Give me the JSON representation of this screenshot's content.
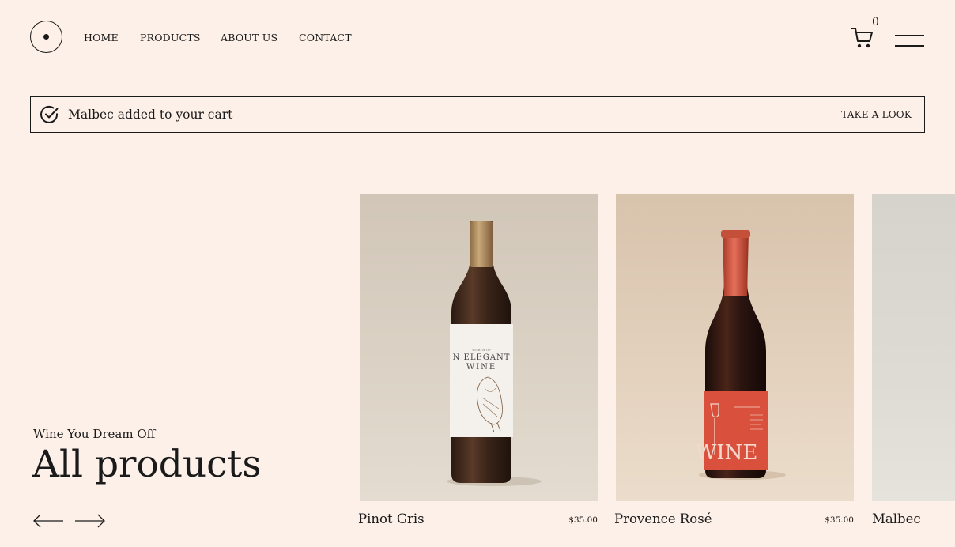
{
  "header": {
    "nav": [
      "HOME",
      "PRODUCTS",
      "ABOUT US",
      "CONTACT"
    ],
    "cart_count": "0"
  },
  "notice": {
    "message": "Malbec added to your cart",
    "action": "TAKE A LOOK"
  },
  "hero": {
    "tagline": "Wine You Dream Off",
    "title": "All products"
  },
  "products": [
    {
      "name": "Pinot Gris",
      "price": "$35.00",
      "label_line1": "N ELEGANT",
      "label_line2": "WINE"
    },
    {
      "name": "Provence Rosé",
      "price": "$35.00",
      "label_text": "WINE"
    },
    {
      "name": "Malbec"
    }
  ],
  "colors": {
    "background": "#fdf0e8",
    "text": "#1a1a1a",
    "rose_label": "#d9503d"
  },
  "icons": [
    "logo-icon",
    "cart-icon",
    "menu-icon",
    "check-circle-icon",
    "arrow-left-icon",
    "arrow-right-icon"
  ]
}
